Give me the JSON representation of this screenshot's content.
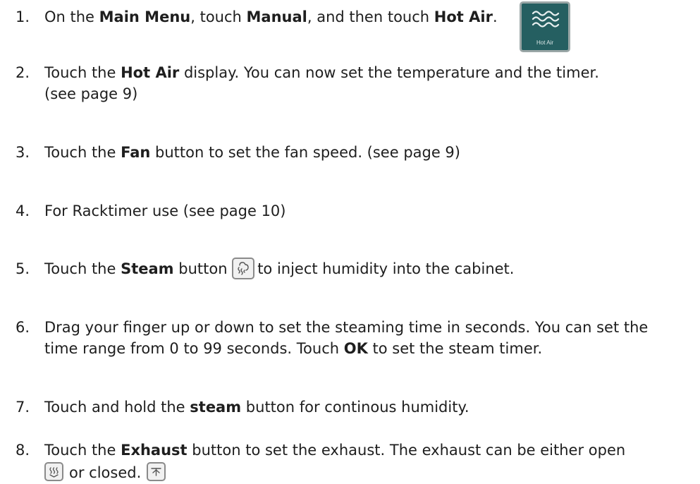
{
  "steps": [
    {
      "number": "1.",
      "parts": [
        "On the ",
        "Main Menu",
        ", touch ",
        "Manual",
        ", and then touch ",
        "Hot Air",
        "."
      ],
      "icon": {
        "name": "hot-air-icon",
        "caption": "Hot Air"
      }
    },
    {
      "number": "2.",
      "parts": [
        "Touch the ",
        "Hot Air",
        " display. You can now set the temperature and the timer."
      ],
      "line2": "(see page 9)"
    },
    {
      "number": "3.",
      "parts": [
        "Touch the ",
        "Fan",
        " button to set the fan speed. (see page 9)"
      ]
    },
    {
      "number": "4.",
      "text": "For Racktimer use (see page 10)"
    },
    {
      "number": "5.",
      "parts": [
        "Touch the ",
        "Steam",
        " button ",
        "to inject humidity into the cabinet."
      ],
      "icon": {
        "name": "steam-icon"
      }
    },
    {
      "number": "6.",
      "line1": "Drag your finger up or down to set the steaming time in seconds. You can set the",
      "parts2": [
        "time range from 0 to 99 seconds. Touch ",
        "OK",
        " to set the steam timer."
      ]
    },
    {
      "number": "7.",
      "parts": [
        "Touch and hold the ",
        "steam",
        " button for continous humidity."
      ]
    },
    {
      "number": "8.",
      "parts": [
        "Touch the ",
        "Exhaust",
        " button  to set the exhaust. The exhaust can be either open"
      ],
      "line2": "or closed.",
      "icons": {
        "open": "exhaust-open-icon",
        "closed": "exhaust-closed-icon"
      }
    }
  ]
}
